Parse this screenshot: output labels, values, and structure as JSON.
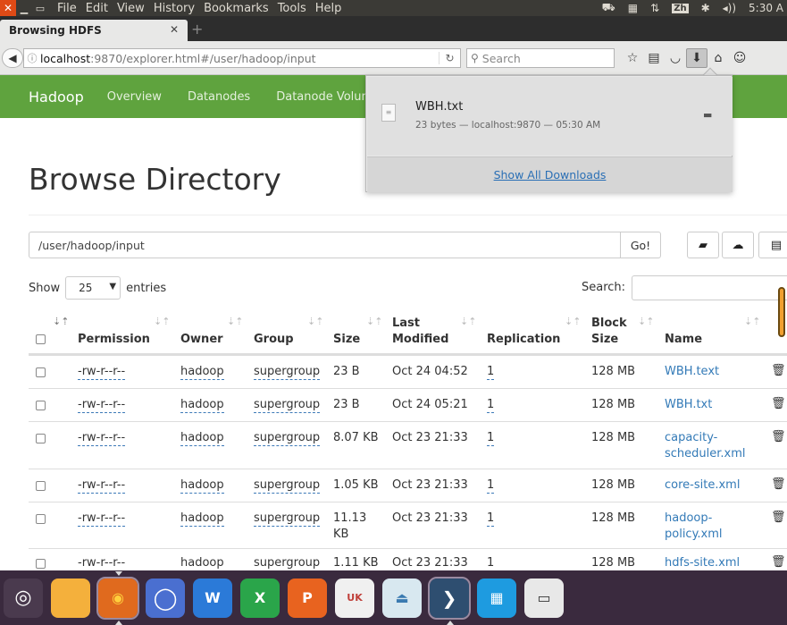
{
  "system_menu": [
    "File",
    "Edit",
    "View",
    "History",
    "Bookmarks",
    "Tools",
    "Help"
  ],
  "tray": {
    "lang": "Zh",
    "volume": "◂))",
    "time": "5:30 A"
  },
  "browser": {
    "tab_title": "Browsing HDFS",
    "url_host": "localhost",
    "url_rest": ":9870/explorer.html#/user/hadoop/input",
    "search_placeholder": "Search"
  },
  "hadoop_nav": {
    "brand": "Hadoop",
    "links": [
      "Overview",
      "Datanodes",
      "Datanode Volun"
    ]
  },
  "page": {
    "title": "Browse Directory",
    "path_value": "/user/hadoop/input",
    "go_label": "Go!",
    "show_label": "Show",
    "entries_value": "25",
    "entries_label": "entries",
    "search_label": "Search:"
  },
  "table": {
    "headers": [
      "Permission",
      "Owner",
      "Group",
      "Size",
      "Last Modified",
      "Replication",
      "Block Size",
      "Name"
    ],
    "rows": [
      {
        "permission": "-rw-r--r--",
        "owner": "hadoop",
        "group": "supergroup",
        "size": "23 B",
        "modified": "Oct 24 04:52",
        "replication": "1",
        "block": "128 MB",
        "name": "WBH.text"
      },
      {
        "permission": "-rw-r--r--",
        "owner": "hadoop",
        "group": "supergroup",
        "size": "23 B",
        "modified": "Oct 24 05:21",
        "replication": "1",
        "block": "128 MB",
        "name": "WBH.txt"
      },
      {
        "permission": "-rw-r--r--",
        "owner": "hadoop",
        "group": "supergroup",
        "size": "8.07 KB",
        "modified": "Oct 23 21:33",
        "replication": "1",
        "block": "128 MB",
        "name": "capacity-scheduler.xml"
      },
      {
        "permission": "-rw-r--r--",
        "owner": "hadoop",
        "group": "supergroup",
        "size": "1.05 KB",
        "modified": "Oct 23 21:33",
        "replication": "1",
        "block": "128 MB",
        "name": "core-site.xml"
      },
      {
        "permission": "-rw-r--r--",
        "owner": "hadoop",
        "group": "supergroup",
        "size": "11.13 KB",
        "modified": "Oct 23 21:33",
        "replication": "1",
        "block": "128 MB",
        "name": "hadoop-policy.xml"
      },
      {
        "permission": "-rw-r--r--",
        "owner": "hadoop",
        "group": "supergroup",
        "size": "1.11 KB",
        "modified": "Oct 23 21:33",
        "replication": "1",
        "block": "128 MB",
        "name": "hdfs-site.xml"
      }
    ]
  },
  "downloads": {
    "file_name": "WBH.txt",
    "file_meta": "23 bytes — localhost:9870 — 05:30 AM",
    "show_all": "Show All Downloads"
  },
  "dock_labels": {
    "writer": "W",
    "calc": "X",
    "impress": "P",
    "store": "UK"
  },
  "colors": {
    "hadoop_green": "#5fa33e",
    "link_blue": "#337ab7",
    "dock_bg": "#3a2a3e"
  }
}
